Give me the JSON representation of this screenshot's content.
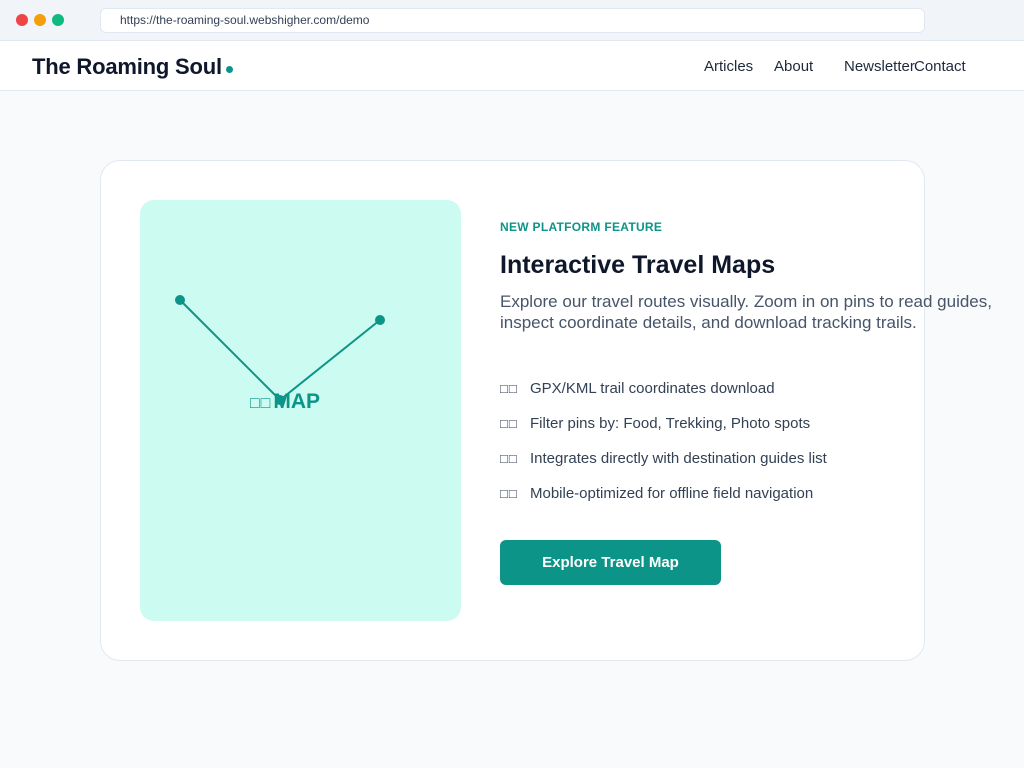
{
  "browser": {
    "url": "https://the-roaming-soul.webshigher.com/demo",
    "traffic_lights": [
      "#ef4444",
      "#f59e0b",
      "#10b981"
    ]
  },
  "header": {
    "brand": "The Roaming Soul",
    "nav": [
      "Articles",
      "About",
      "Newsletter",
      "Contact"
    ]
  },
  "colors": {
    "accent": "#0d9488",
    "map_bg": "#ccfbf1",
    "text_dark": "#0f172a",
    "text_muted": "#475569"
  },
  "feature_card": {
    "map": {
      "label_icon": "□□",
      "label": "MAP",
      "pin_icon": "map-pin-icon"
    },
    "eyebrow": "NEW PLATFORM FEATURE",
    "title": "Interactive Travel Maps",
    "description": "Explore our travel routes visually. Zoom in on pins to read guides, inspect coordinate details, and download tracking trails.",
    "features": [
      {
        "icon": "□□",
        "text": "GPX/KML trail coordinates download"
      },
      {
        "icon": "□□",
        "text": "Filter pins by: Food, Trekking, Photo spots"
      },
      {
        "icon": "□□",
        "text": "Integrates directly with destination guides list"
      },
      {
        "icon": "□□",
        "text": "Mobile-optimized for offline field navigation"
      }
    ],
    "cta_label": "Explore Travel Map"
  }
}
